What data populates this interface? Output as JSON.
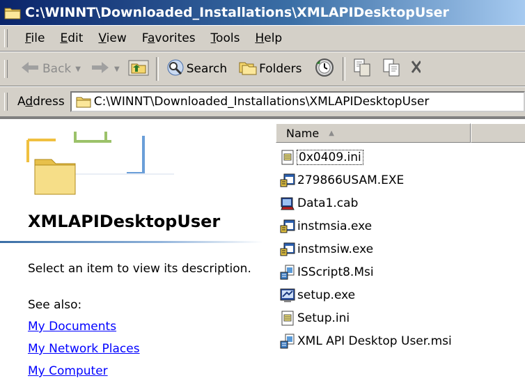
{
  "window": {
    "title": "C:\\WINNT\\Downloaded_Installations\\XMLAPIDesktopUser"
  },
  "menu": [
    {
      "accel": "F",
      "rest": "ile"
    },
    {
      "accel": "E",
      "rest": "dit"
    },
    {
      "accel": "V",
      "rest": "iew"
    },
    {
      "pre": "F",
      "accel": "a",
      "rest": "vorites"
    },
    {
      "accel": "T",
      "rest": "ools"
    },
    {
      "accel": "H",
      "rest": "elp"
    }
  ],
  "toolbar": {
    "back_label": "Back",
    "search_label": "Search",
    "folders_label": "Folders"
  },
  "address": {
    "label_accel": "d",
    "label_pre": "A",
    "label_rest": "dress",
    "value": "C:\\WINNT\\Downloaded_Installations\\XMLAPIDesktopUser"
  },
  "left_pane": {
    "folder_name": "XMLAPIDesktopUser",
    "description": "Select an item to view its description.",
    "see_also": "See also:",
    "links": [
      "My Documents",
      "My Network Places",
      "My Computer"
    ]
  },
  "file_list": {
    "column_name": "Name",
    "files": [
      {
        "name": "0x0409.ini",
        "icon": "ini-file-icon"
      },
      {
        "name": "279866USAM.EXE",
        "icon": "exe-file-icon"
      },
      {
        "name": "Data1.cab",
        "icon": "cab-file-icon"
      },
      {
        "name": "instmsia.exe",
        "icon": "exe-file-icon"
      },
      {
        "name": "instmsiw.exe",
        "icon": "exe-file-icon"
      },
      {
        "name": "ISScript8.Msi",
        "icon": "msi-file-icon"
      },
      {
        "name": "setup.exe",
        "icon": "setup-exe-icon"
      },
      {
        "name": "Setup.ini",
        "icon": "ini-file-icon"
      },
      {
        "name": "XML API Desktop User.msi",
        "icon": "msi-file-icon"
      }
    ]
  }
}
